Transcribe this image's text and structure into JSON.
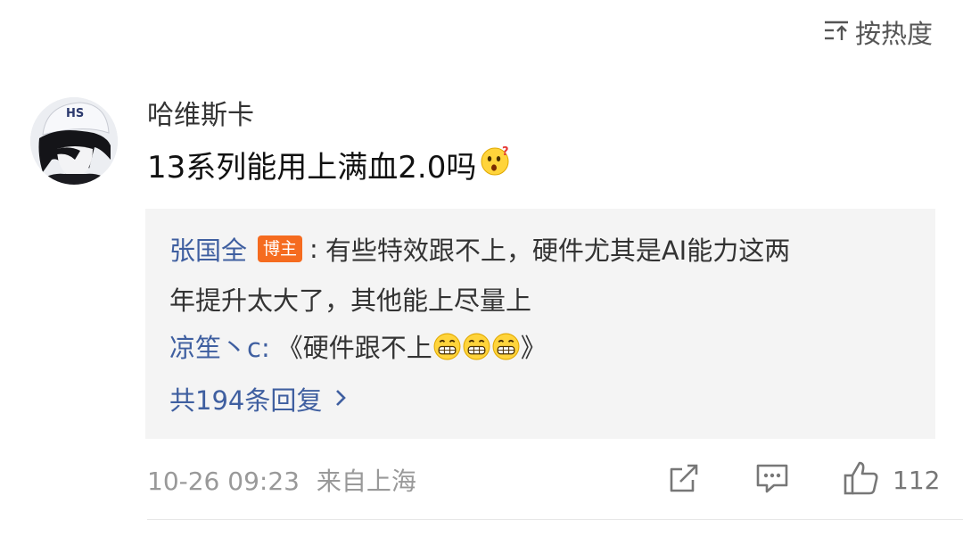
{
  "sort": {
    "label": "按热度"
  },
  "comment": {
    "username": "哈维斯卡",
    "text": "13系列能用上满血2.0吗"
  },
  "replies": {
    "reply1": {
      "author": "张国全",
      "badge": "博主",
      "colon": ":",
      "line1": "有些特效跟不上，硬件尤其是AI能力这两",
      "line2": "年提升太大了，其他能上尽量上"
    },
    "reply2": {
      "author": "凉笙丶c:",
      "text_prefix": "《硬件跟不上",
      "text_suffix": "》"
    },
    "more_label": "共194条回复"
  },
  "footer": {
    "datetime": "10-26 09:23",
    "location": "来自上海",
    "like_count": "112"
  },
  "colors": {
    "link": "#3f5fa0",
    "badge": "#f56b1f",
    "reply_bg": "#f4f4f4",
    "meta": "#999999"
  },
  "icons": [
    "sort-icon",
    "share-icon",
    "comment-icon",
    "like-icon",
    "chevron-right-icon",
    "thinking-emoji-icon",
    "grin-emoji-icon"
  ]
}
